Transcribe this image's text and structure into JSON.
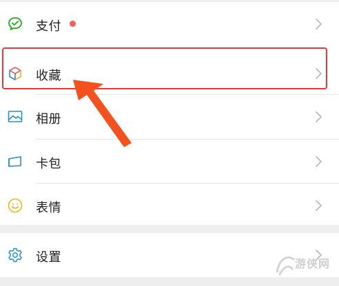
{
  "menu": {
    "items": [
      {
        "label": "支付",
        "icon": "wechat-pay-icon",
        "has_badge": true
      },
      {
        "label": "收藏",
        "icon": "favorites-cube-icon",
        "has_badge": false
      },
      {
        "label": "相册",
        "icon": "album-image-icon",
        "has_badge": false
      },
      {
        "label": "卡包",
        "icon": "card-wallet-icon",
        "has_badge": false
      },
      {
        "label": "表情",
        "icon": "sticker-face-icon",
        "has_badge": false
      }
    ],
    "settings": {
      "label": "设置",
      "icon": "gear-icon"
    }
  },
  "colors": {
    "badge": "#f25e5e",
    "annotation": "#e53935",
    "green": "#1aad19",
    "blue": "#1e90c8",
    "yellow": "#f2b21a"
  },
  "watermark": {
    "text": "游侠网"
  }
}
